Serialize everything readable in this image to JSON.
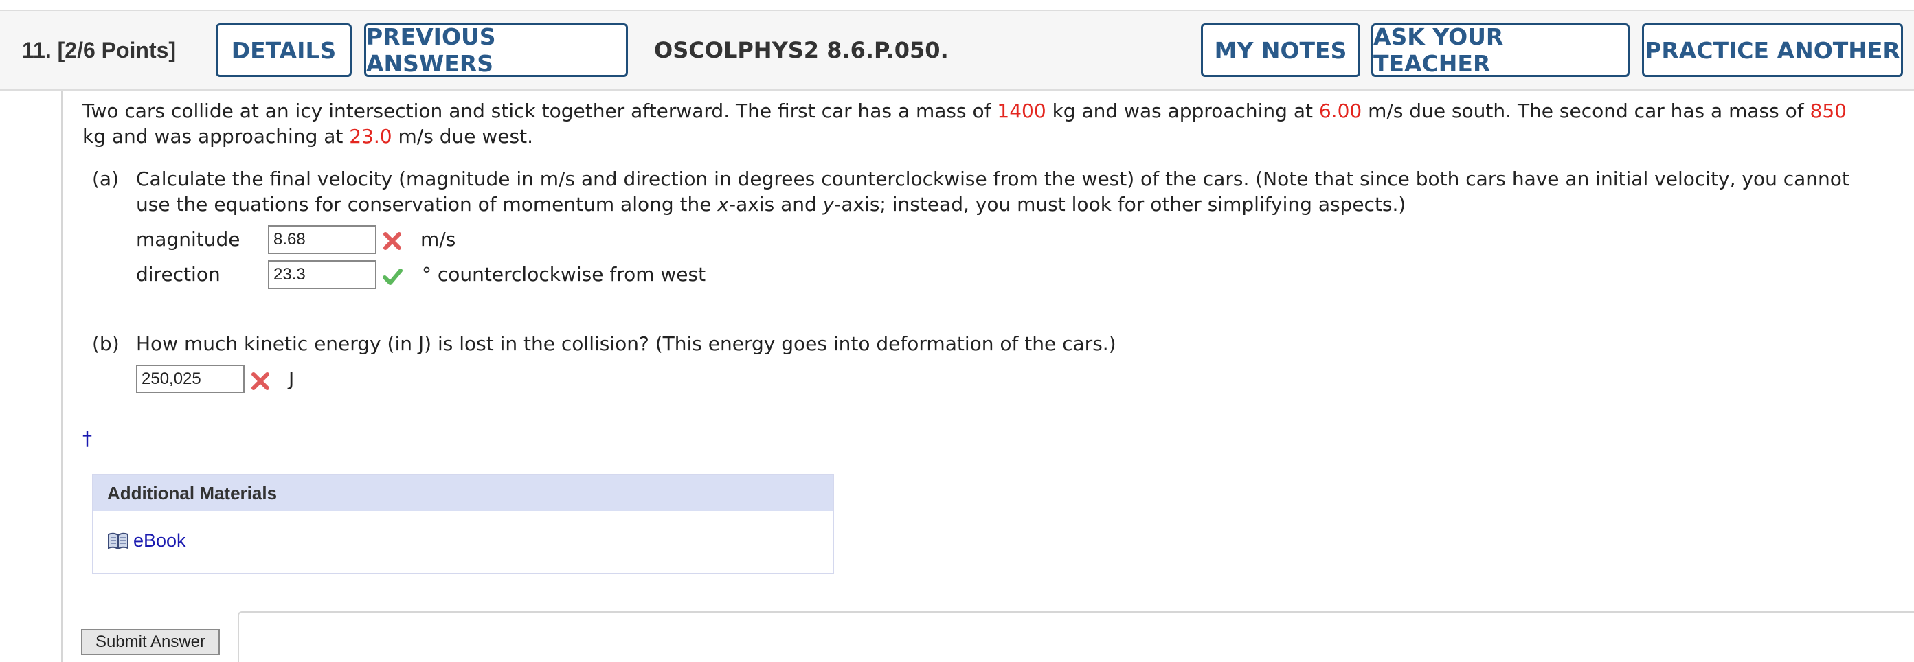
{
  "header": {
    "question_label": "11.  [2/6 Points]",
    "details_label": "DETAILS",
    "previous_answers_label": "PREVIOUS ANSWERS",
    "question_code": "OSCOLPHYS2 8.6.P.050.",
    "my_notes_label": "MY NOTES",
    "ask_teacher_label": "ASK YOUR TEACHER",
    "practice_another_label": "PRACTICE ANOTHER"
  },
  "problem": {
    "t1": "Two cars collide at an icy intersection and stick together afterward. The first car has a mass of ",
    "m1": "1400",
    "t2": " kg and was approaching at ",
    "v1": "6.00",
    "t3": " m/s due south. The second car has a mass of ",
    "m2": "850",
    "t4": " kg and was approaching at ",
    "v2": "23.0",
    "t5": " m/s due west."
  },
  "part_a": {
    "label": "(a)",
    "text1": "Calculate the final velocity (magnitude in m/s and direction in degrees counterclockwise from the west) of the cars. (Note that since both cars have an initial velocity, you cannot use the equations for conservation of momentum along the ",
    "x": "x",
    "text2": "-axis and ",
    "y": "y",
    "text3": "-axis; instead, you must look for other simplifying aspects.)",
    "magnitude_label": "magnitude",
    "magnitude_value": "8.68",
    "magnitude_status": "incorrect",
    "magnitude_unit": "m/s",
    "direction_label": "direction",
    "direction_value": "23.3",
    "direction_status": "correct",
    "direction_unit": "° counterclockwise from west"
  },
  "part_b": {
    "label": "(b)",
    "text": "How much kinetic energy (in J) is lost in the collision? (This energy goes into deformation of the cars.)",
    "value": "250,025",
    "status": "incorrect",
    "unit": "J"
  },
  "dagger": "†",
  "additional_materials": {
    "title": "Additional Materials",
    "ebook_label": "eBook",
    "icon": "book-icon"
  },
  "submit_label": "Submit Answer",
  "colors": {
    "button_border": "#1f4e79",
    "button_text": "#2a5a8a",
    "highlight_red": "#e3261f",
    "correct_green": "#5cb85c",
    "incorrect_red": "#e05a5a"
  }
}
